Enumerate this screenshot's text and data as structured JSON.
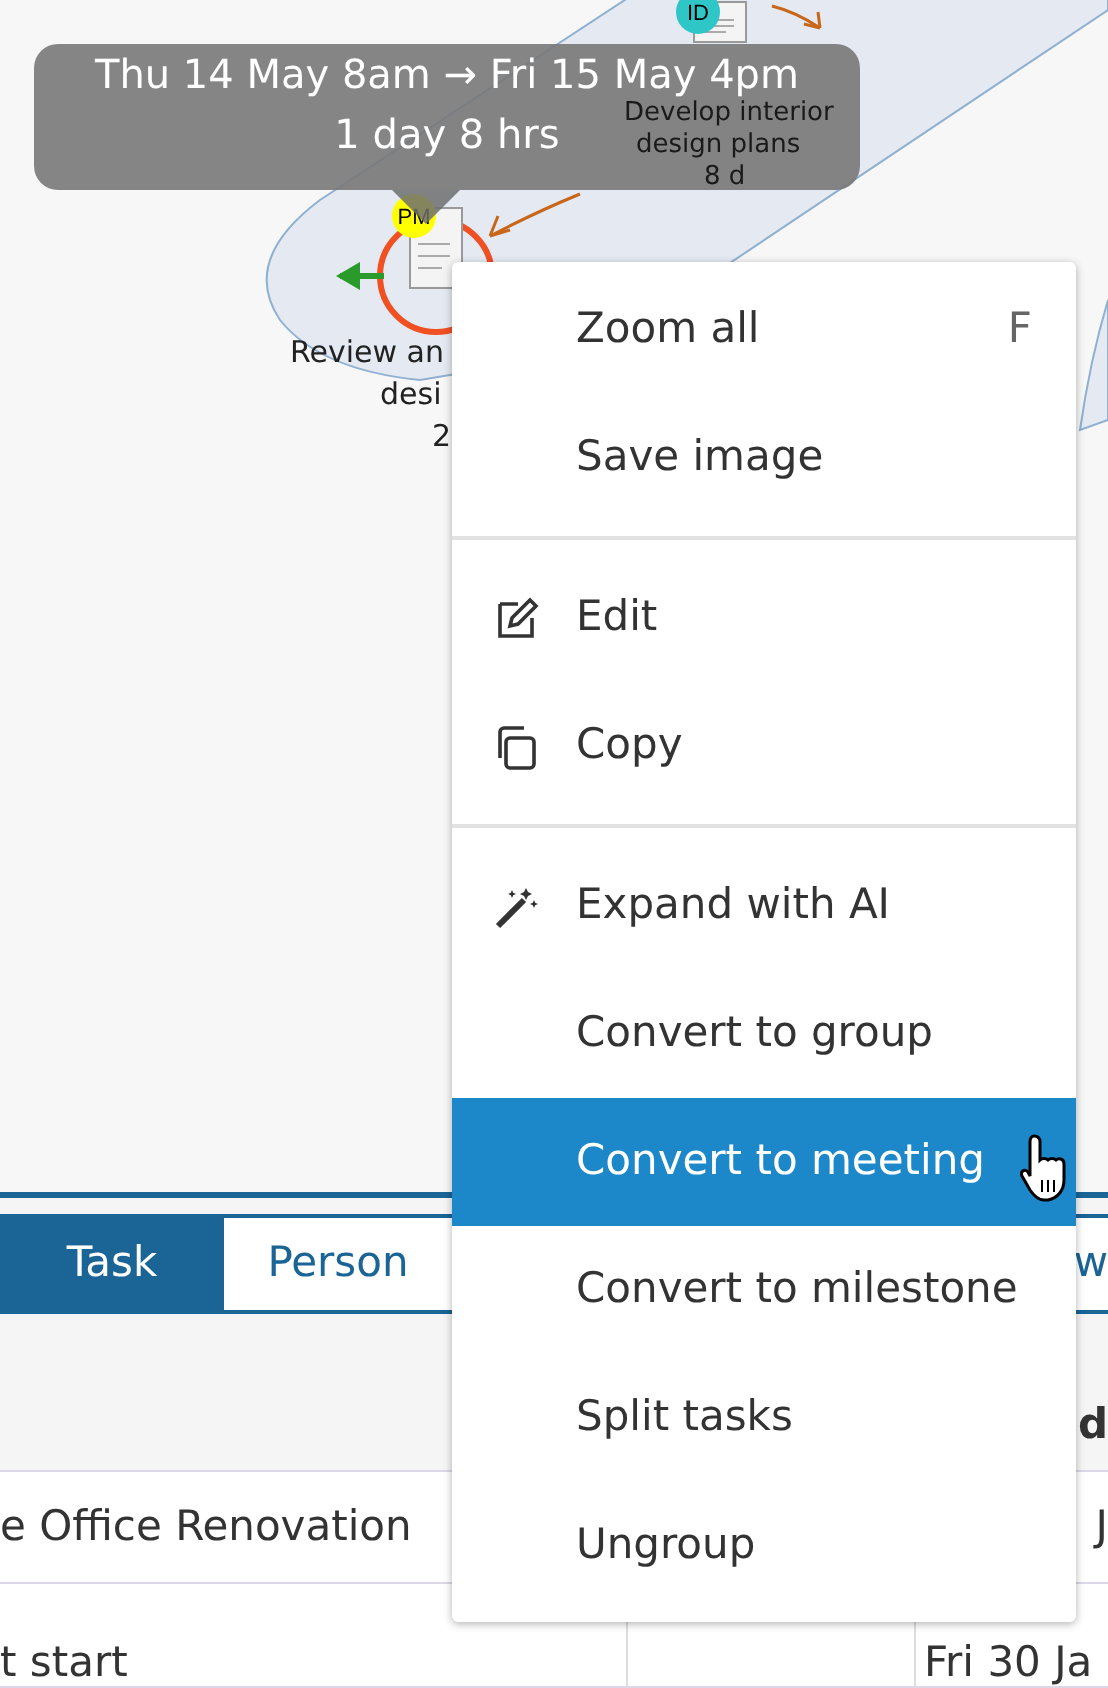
{
  "diagram": {
    "nodes": [
      {
        "initials": "ID",
        "color": "#2ec6c6",
        "critical": false,
        "label_lines": [
          "Develop interior",
          "design plans",
          "8 d"
        ]
      },
      {
        "initials": "PM",
        "color": "#ffff00",
        "critical": true,
        "label_lines": [
          "Review an",
          "desi",
          "2"
        ]
      }
    ]
  },
  "tooltip": {
    "lines": [
      "Thu 14 May 8am → Fri 15 May 4pm",
      "1 day 8 hrs"
    ]
  },
  "context_menu": {
    "sections": [
      [
        {
          "label": "Zoom all",
          "shortcut": "F",
          "kind": "plain",
          "selected": false
        },
        {
          "label": "Save image",
          "kind": "plain",
          "selected": false
        }
      ],
      [
        {
          "label": "Edit",
          "kind": "edit",
          "selected": false
        },
        {
          "label": "Copy",
          "kind": "copy",
          "selected": false
        }
      ],
      [
        {
          "label": "Expand with AI",
          "kind": "ai",
          "selected": false
        },
        {
          "label": "Convert to group",
          "kind": "plain",
          "selected": false
        },
        {
          "label": "Convert to meeting",
          "kind": "plain",
          "selected": true
        },
        {
          "label": "Convert to milestone",
          "kind": "plain",
          "selected": false
        },
        {
          "label": "Split tasks",
          "kind": "plain",
          "selected": false
        },
        {
          "label": "Ungroup",
          "kind": "plain",
          "selected": false
        }
      ]
    ]
  },
  "tabs": [
    {
      "label": "Task",
      "selected": true
    },
    {
      "label": "Person",
      "selected": false
    },
    {
      "label": "w",
      "selected": false
    }
  ],
  "table": {
    "column_3_heading": "d",
    "rows": [
      {
        "column_1": "e Office Renovation",
        "column_3": "J"
      },
      {
        "column_1": "t start",
        "column_3": "Fri 30 Ja"
      }
    ]
  }
}
